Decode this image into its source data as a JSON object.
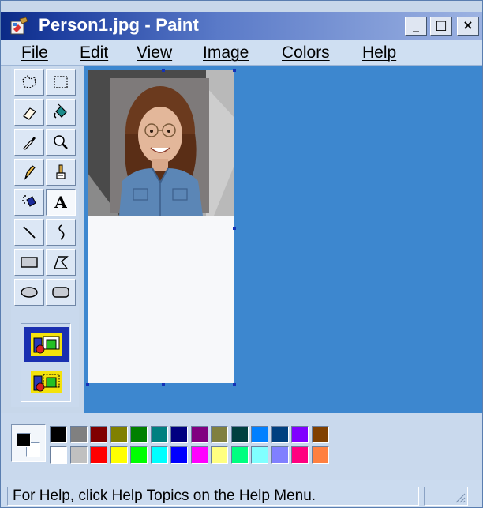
{
  "window": {
    "title": "Person1.jpg - Paint",
    "minimize_label": "_",
    "maximize_label": "□",
    "close_label": "×"
  },
  "menu": {
    "items": [
      {
        "label": "File"
      },
      {
        "label": "Edit"
      },
      {
        "label": "View"
      },
      {
        "label": "Image"
      },
      {
        "label": "Colors"
      },
      {
        "label": "Help"
      }
    ]
  },
  "toolbox": {
    "tools": [
      {
        "icon": "free-form-select-icon"
      },
      {
        "icon": "rectangle-select-icon"
      },
      {
        "icon": "eraser-icon"
      },
      {
        "icon": "fill-with-color-icon"
      },
      {
        "icon": "pick-color-icon"
      },
      {
        "icon": "magnifier-icon"
      },
      {
        "icon": "pencil-icon"
      },
      {
        "icon": "brush-icon"
      },
      {
        "icon": "airbrush-icon"
      },
      {
        "icon": "text-icon",
        "glyph": "A",
        "pressed": true
      },
      {
        "icon": "line-icon"
      },
      {
        "icon": "curve-icon"
      },
      {
        "icon": "rectangle-icon"
      },
      {
        "icon": "polygon-icon"
      },
      {
        "icon": "ellipse-icon"
      },
      {
        "icon": "rounded-rectangle-icon"
      }
    ],
    "options": [
      {
        "icon": "opaque-background-icon",
        "selected": true
      },
      {
        "icon": "transparent-background-icon",
        "selected": false
      }
    ]
  },
  "canvas": {
    "background": "#f7f8fa",
    "image": "photo-portrait"
  },
  "palette": {
    "foreground": "#000000",
    "background": "#ffffff",
    "colors_row1": [
      "#000000",
      "#808080",
      "#800000",
      "#808000",
      "#008000",
      "#008080",
      "#000080",
      "#800080",
      "#808040",
      "#004040",
      "#0080ff",
      "#004080",
      "#8000ff",
      "#804000"
    ],
    "colors_row2": [
      "#ffffff",
      "#c0c0c0",
      "#ff0000",
      "#ffff00",
      "#00ff00",
      "#00ffff",
      "#0000ff",
      "#ff00ff",
      "#ffff80",
      "#00ff80",
      "#80ffff",
      "#8080ff",
      "#ff0080",
      "#ff8040"
    ]
  },
  "status": {
    "text": "For Help, click Help Topics on the Help Menu."
  },
  "colors": {
    "workspace": "#3d87cf",
    "title_bar": "#0b2a86",
    "chrome": "#c9d9ed"
  }
}
